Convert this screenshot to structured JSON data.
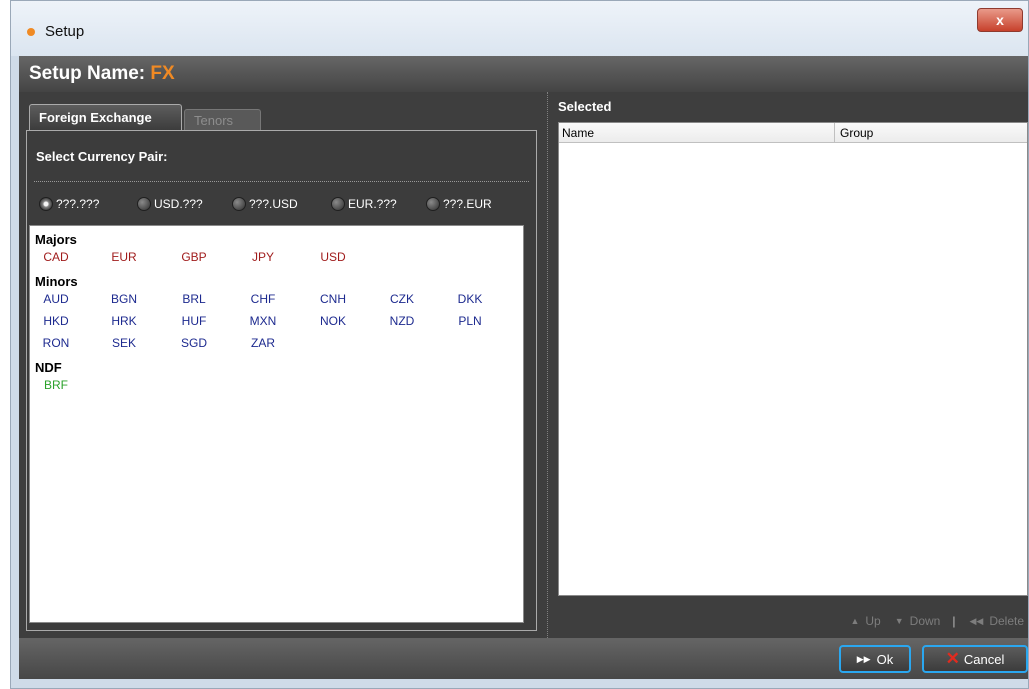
{
  "window": {
    "title": "Setup",
    "close_glyph": "x",
    "accent_color": "#f08a24"
  },
  "header": {
    "label": "Setup Name:",
    "value": "FX"
  },
  "tabs": [
    {
      "label": "Foreign Exchange",
      "active": true
    },
    {
      "label": "Tenors",
      "active": false
    }
  ],
  "left": {
    "select_label": "Select Currency Pair:",
    "radios": [
      {
        "label": "???.???",
        "selected": true
      },
      {
        "label": "USD.???",
        "selected": false
      },
      {
        "label": "???.USD",
        "selected": false
      },
      {
        "label": "EUR.???",
        "selected": false
      },
      {
        "label": "???.EUR",
        "selected": false
      }
    ],
    "groups": [
      {
        "label": "Majors",
        "color": "#a01c1c",
        "items": [
          "CAD",
          "EUR",
          "GBP",
          "JPY",
          "USD"
        ]
      },
      {
        "label": "Minors",
        "color": "#1d2a8f",
        "items": [
          "AUD",
          "BGN",
          "BRL",
          "CHF",
          "CNH",
          "CZK",
          "DKK",
          "HKD",
          "HRK",
          "HUF",
          "MXN",
          "NOK",
          "NZD",
          "PLN",
          "RON",
          "SEK",
          "SGD",
          "ZAR"
        ]
      },
      {
        "label": "NDF",
        "color": "#2aa12a",
        "items": [
          "BRF"
        ]
      }
    ]
  },
  "right": {
    "selected_label": "Selected",
    "columns": [
      "Name",
      "Group"
    ],
    "actions": {
      "up": "Up",
      "down": "Down",
      "delete": "Delete"
    }
  },
  "footer": {
    "ok": "Ok",
    "cancel": "Cancel"
  }
}
